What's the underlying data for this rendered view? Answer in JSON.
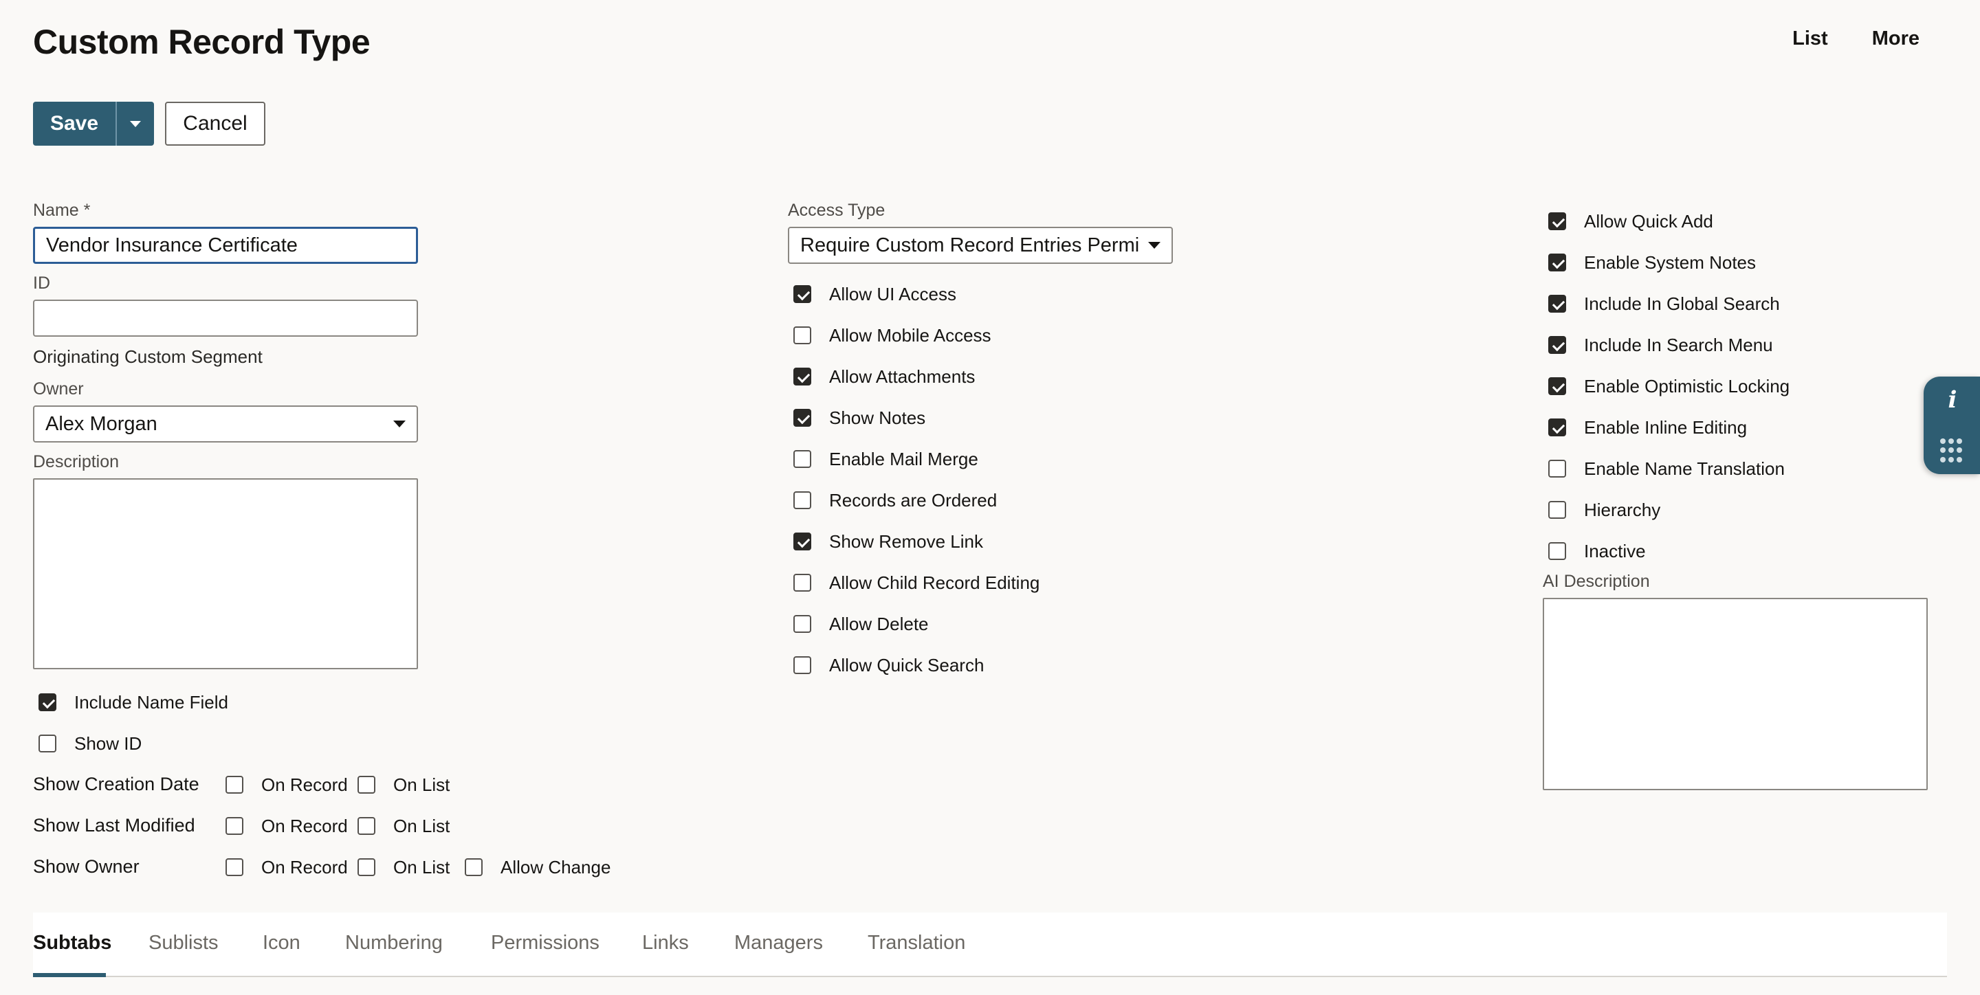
{
  "header": {
    "title": "Custom Record Type",
    "links": [
      "List",
      "More"
    ]
  },
  "toolbar": {
    "save_label": "Save",
    "cancel_label": "Cancel"
  },
  "left": {
    "name_label": "Name *",
    "name_value": "Vendor Insurance Certificate",
    "id_label": "ID",
    "id_value": "",
    "origin_label": "Originating Custom Segment",
    "owner_label": "Owner",
    "owner_value": "Alex Morgan",
    "description_label": "Description",
    "include_name_field": {
      "label": "Include Name Field",
      "checked": true
    },
    "show_id": {
      "label": "Show ID",
      "checked": false
    },
    "show_rows": [
      {
        "label": "Show Creation Date",
        "options": [
          {
            "label": "On Record",
            "checked": false
          },
          {
            "label": "On List",
            "checked": false
          }
        ]
      },
      {
        "label": "Show Last Modified",
        "options": [
          {
            "label": "On Record",
            "checked": false
          },
          {
            "label": "On List",
            "checked": false
          }
        ]
      },
      {
        "label": "Show Owner",
        "options": [
          {
            "label": "On Record",
            "checked": false
          },
          {
            "label": "On List",
            "checked": false
          },
          {
            "label": "Allow Change",
            "checked": false
          }
        ]
      }
    ]
  },
  "middle": {
    "access_type_label": "Access Type",
    "access_type_value": "Require Custom Record Entries Permission",
    "checkboxes": [
      {
        "label": "Allow UI Access",
        "checked": true
      },
      {
        "label": "Allow Mobile Access",
        "checked": false
      },
      {
        "label": "Allow Attachments",
        "checked": true
      },
      {
        "label": "Show Notes",
        "checked": true
      },
      {
        "label": "Enable Mail Merge",
        "checked": false
      },
      {
        "label": "Records are Ordered",
        "checked": false
      },
      {
        "label": "Show Remove Link",
        "checked": true
      },
      {
        "label": "Allow Child Record Editing",
        "checked": false
      },
      {
        "label": "Allow Delete",
        "checked": false
      },
      {
        "label": "Allow Quick Search",
        "checked": false
      }
    ]
  },
  "right": {
    "checkboxes": [
      {
        "label": "Allow Quick Add",
        "checked": true
      },
      {
        "label": "Enable System Notes",
        "checked": true
      },
      {
        "label": "Include In Global Search",
        "checked": true
      },
      {
        "label": "Include In Search Menu",
        "checked": true
      },
      {
        "label": "Enable Optimistic Locking",
        "checked": true
      },
      {
        "label": "Enable Inline Editing",
        "checked": true
      },
      {
        "label": "Enable Name Translation",
        "checked": false
      },
      {
        "label": "Hierarchy",
        "checked": false
      },
      {
        "label": "Inactive",
        "checked": false
      }
    ],
    "ai_description_label": "AI Description"
  },
  "tabs": [
    {
      "label": "Subtabs",
      "active": true
    },
    {
      "label": "Sublists",
      "active": false
    },
    {
      "label": "Icon",
      "active": false
    },
    {
      "label": "Numbering",
      "active": false
    },
    {
      "label": "Permissions",
      "active": false
    },
    {
      "label": "Links",
      "active": false
    },
    {
      "label": "Managers",
      "active": false
    },
    {
      "label": "Translation",
      "active": false
    }
  ],
  "side_widget": {
    "icons": [
      "info-icon",
      "apps-grid-icon"
    ],
    "color": "#2e5d72"
  }
}
